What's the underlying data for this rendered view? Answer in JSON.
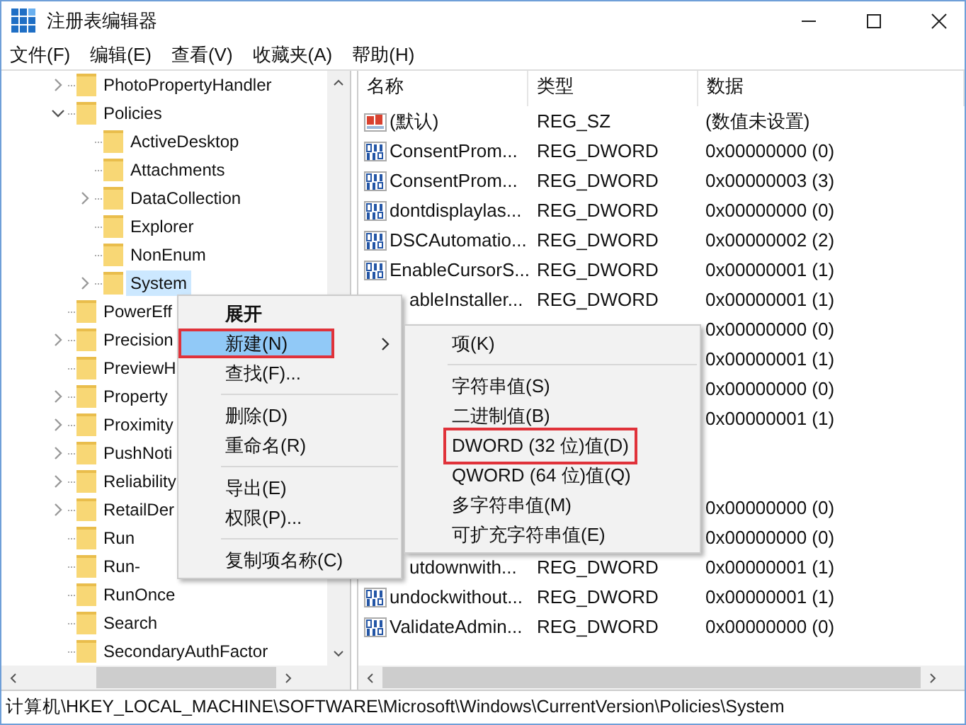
{
  "window": {
    "title": "注册表编辑器"
  },
  "menu_bar": [
    "文件(F)",
    "编辑(E)",
    "查看(V)",
    "收藏夹(A)",
    "帮助(H)"
  ],
  "tree": [
    {
      "label": "PhotoPropertyHandler",
      "expanded": false,
      "selected": false
    },
    {
      "label": "Policies",
      "expanded": true,
      "selected": false,
      "children": [
        {
          "label": "ActiveDesktop",
          "selected": false
        },
        {
          "label": "Attachments",
          "selected": false
        },
        {
          "label": "DataCollection",
          "expanded": false,
          "selected": false
        },
        {
          "label": "Explorer",
          "selected": false
        },
        {
          "label": "NonEnum",
          "selected": false
        },
        {
          "label": "System",
          "expanded": false,
          "selected": true
        }
      ]
    },
    {
      "label": "PowerEff",
      "selected": false
    },
    {
      "label": "Precision",
      "expanded": false,
      "selected": false
    },
    {
      "label": "PreviewH",
      "selected": false
    },
    {
      "label": "Property",
      "expanded": false,
      "selected": false
    },
    {
      "label": "Proximity",
      "expanded": false,
      "selected": false
    },
    {
      "label": "PushNoti",
      "expanded": false,
      "selected": false
    },
    {
      "label": "Reliability",
      "expanded": false,
      "selected": false
    },
    {
      "label": "RetailDer",
      "expanded": false,
      "selected": false
    },
    {
      "label": "Run",
      "selected": false
    },
    {
      "label": "Run-",
      "selected": false
    },
    {
      "label": "RunOnce",
      "selected": false
    },
    {
      "label": "Search",
      "selected": false
    },
    {
      "label": "SecondaryAuthFactor",
      "selected": false
    }
  ],
  "list": {
    "columns": [
      "名称",
      "类型",
      "数据"
    ],
    "rows": [
      {
        "kind": "string",
        "name": "(默认)",
        "type": "REG_SZ",
        "data": "(数值未设置)"
      },
      {
        "kind": "binary",
        "name": "ConsentProm...",
        "type": "REG_DWORD",
        "data": "0x00000000 (0)"
      },
      {
        "kind": "binary",
        "name": "ConsentProm...",
        "type": "REG_DWORD",
        "data": "0x00000003 (3)"
      },
      {
        "kind": "binary",
        "name": "dontdisplaylas...",
        "type": "REG_DWORD",
        "data": "0x00000000 (0)"
      },
      {
        "kind": "binary",
        "name": "DSCAutomatio...",
        "type": "REG_DWORD",
        "data": "0x00000002 (2)"
      },
      {
        "kind": "binary",
        "name": "EnableCursorS...",
        "type": "REG_DWORD",
        "data": "0x00000001 (1)"
      },
      {
        "name": "ableInstaller...",
        "type": "REG_DWORD",
        "data": "0x00000001 (1)"
      },
      {
        "data": "0x00000000 (0)"
      },
      {
        "data": "0x00000001 (1)"
      },
      {
        "data": "0x00000000 (0)"
      },
      {
        "data": "0x00000001 (1)"
      },
      {},
      {},
      {
        "data": "0x00000000 (0)"
      },
      {
        "data": "0x00000000 (0)"
      },
      {
        "name": "utdownwith...",
        "type": "REG_DWORD",
        "data": "0x00000001 (1)"
      },
      {
        "kind": "binary",
        "name": "undockwithout...",
        "type": "REG_DWORD",
        "data": "0x00000001 (1)"
      },
      {
        "kind": "binary",
        "name": "ValidateAdmin...",
        "type": "REG_DWORD",
        "data": "0x00000000 (0)"
      }
    ]
  },
  "context_menu": [
    {
      "kind": "item",
      "label": "展开",
      "default": true,
      "selected": false,
      "submenu": false,
      "annotated": false
    },
    {
      "kind": "item",
      "label": "新建(N)",
      "default": false,
      "selected": true,
      "submenu": true,
      "annotated": true
    },
    {
      "kind": "item",
      "label": "查找(F)...",
      "default": false,
      "selected": false,
      "submenu": false,
      "annotated": false
    },
    {
      "kind": "separator"
    },
    {
      "kind": "item",
      "label": "删除(D)",
      "default": false,
      "selected": false,
      "submenu": false,
      "annotated": false
    },
    {
      "kind": "item",
      "label": "重命名(R)",
      "default": false,
      "selected": false,
      "submenu": false,
      "annotated": false
    },
    {
      "kind": "separator"
    },
    {
      "kind": "item",
      "label": "导出(E)",
      "default": false,
      "selected": false,
      "submenu": false,
      "annotated": false
    },
    {
      "kind": "item",
      "label": "权限(P)...",
      "default": false,
      "selected": false,
      "submenu": false,
      "annotated": false
    },
    {
      "kind": "separator"
    },
    {
      "kind": "item",
      "label": "复制项名称(C)",
      "default": false,
      "selected": false,
      "submenu": false,
      "annotated": false
    }
  ],
  "submenu": [
    {
      "kind": "item",
      "label": "项(K)",
      "annotated": false
    },
    {
      "kind": "separator"
    },
    {
      "kind": "item",
      "label": "字符串值(S)",
      "annotated": false
    },
    {
      "kind": "item",
      "label": "二进制值(B)",
      "annotated": false
    },
    {
      "kind": "item",
      "label": "DWORD (32 位)值(D)",
      "annotated": true
    },
    {
      "kind": "item",
      "label": "QWORD (64 位)值(Q)",
      "annotated": false
    },
    {
      "kind": "item",
      "label": "多字符串值(M)",
      "annotated": false
    },
    {
      "kind": "item",
      "label": "可扩充字符串值(E)",
      "annotated": false
    }
  ],
  "status_bar": "计算机\\HKEY_LOCAL_MACHINE\\SOFTWARE\\Microsoft\\Windows\\CurrentVersion\\Policies\\System"
}
